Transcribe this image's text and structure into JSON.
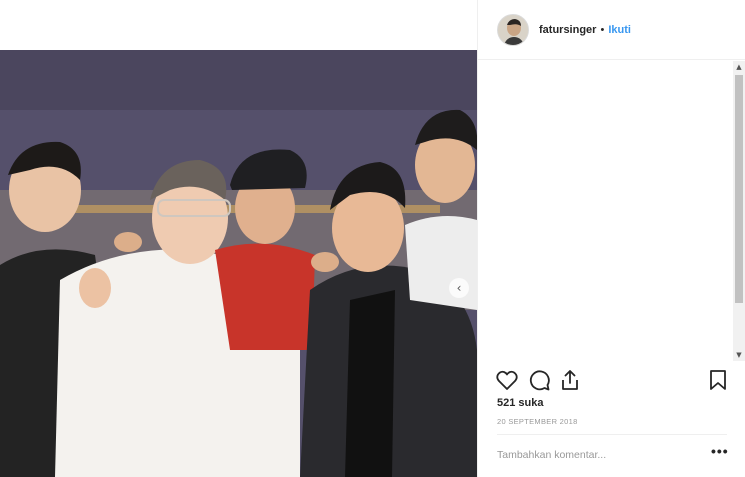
{
  "post": {
    "photo_alt": "group photo",
    "carousel_arrow": "‹"
  },
  "header": {
    "username": "fatursinger",
    "separator": "•",
    "follow_label": "Ikuti"
  },
  "scrollbar": {
    "up_arrow": "▲",
    "down_arrow": "▼"
  },
  "actions": {
    "icons": [
      "heart-icon",
      "comment-icon",
      "share-icon",
      "bookmark-icon"
    ]
  },
  "likes": "521 suka",
  "date": "20 SEPTEMBER 2018",
  "comment": {
    "placeholder": "Tambahkan komentar...",
    "more_label": "•••"
  }
}
